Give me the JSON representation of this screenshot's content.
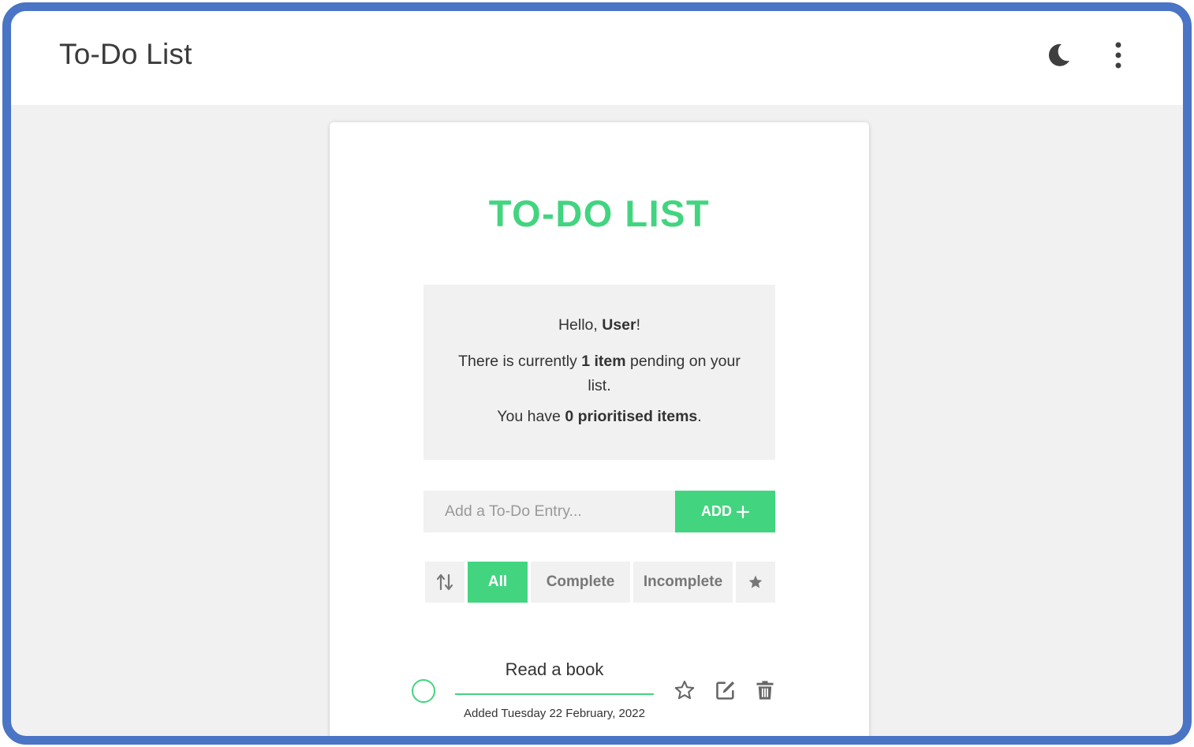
{
  "header": {
    "app_title": "To-Do List",
    "icons": [
      "moon-icon",
      "more-vertical-icon"
    ]
  },
  "card": {
    "title": "TO-DO LIST",
    "summary": {
      "greeting_prefix": "Hello, ",
      "user_name": "User",
      "greeting_suffix": "!",
      "pending_prefix": "There is currently ",
      "pending_count": "1 item",
      "pending_suffix": " pending on your list.",
      "prioritised_prefix": "You have ",
      "prioritised_count": "0 prioritised items",
      "prioritised_suffix": "."
    },
    "entry": {
      "placeholder": "Add a To-Do Entry...",
      "value": "",
      "add_label": "ADD",
      "add_icon": "plus-icon"
    },
    "filters": {
      "sort_icon": "sort-arrows-icon",
      "items": [
        {
          "label": "All",
          "active": true
        },
        {
          "label": "Complete",
          "active": false
        },
        {
          "label": "Incomplete",
          "active": false
        }
      ],
      "priority_icon": "star-filled-icon"
    },
    "todos": [
      {
        "text": "Read a book",
        "added": "Added Tuesday 22 February, 2022",
        "completed": false,
        "prioritised": false,
        "icons": [
          "star-outline-icon",
          "edit-icon",
          "trash-icon"
        ]
      }
    ]
  },
  "colors": {
    "accent": "#43d480",
    "frame_border": "#4a74c5",
    "background": "#f1f1f1",
    "panel": "#f1f1f1",
    "icon_gray": "#777777"
  }
}
